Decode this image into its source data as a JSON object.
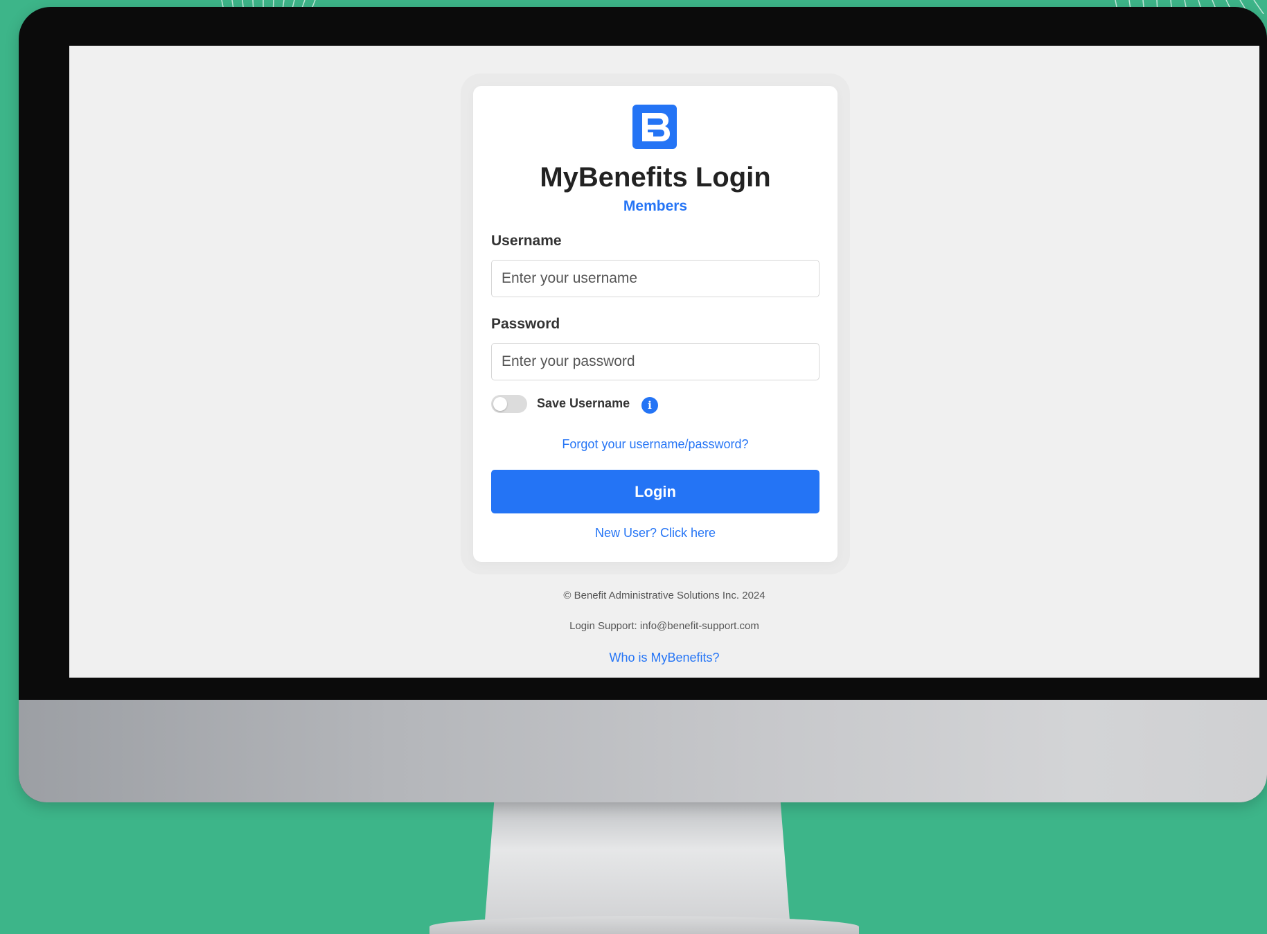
{
  "colors": {
    "background": "#3db589",
    "accent": "#2474f5",
    "screen": "#f0f0f0"
  },
  "login": {
    "logo_icon": "mybenefits-logo-icon",
    "title": "MyBenefits Login",
    "subtitle": "Members",
    "username_label": "Username",
    "username_placeholder": "Enter your username",
    "username_value": "",
    "password_label": "Password",
    "password_placeholder": "Enter your password",
    "password_value": "",
    "save_username_label": "Save Username",
    "save_username_on": false,
    "info_icon": "i",
    "forgot_link": "Forgot your username/password?",
    "login_button": "Login",
    "new_user_link": "New User? Click here"
  },
  "footer": {
    "copyright": "© Benefit Administrative Solutions Inc. 2024",
    "support": "Login Support: info@benefit-support.com",
    "who_link": "Who is MyBenefits?"
  }
}
